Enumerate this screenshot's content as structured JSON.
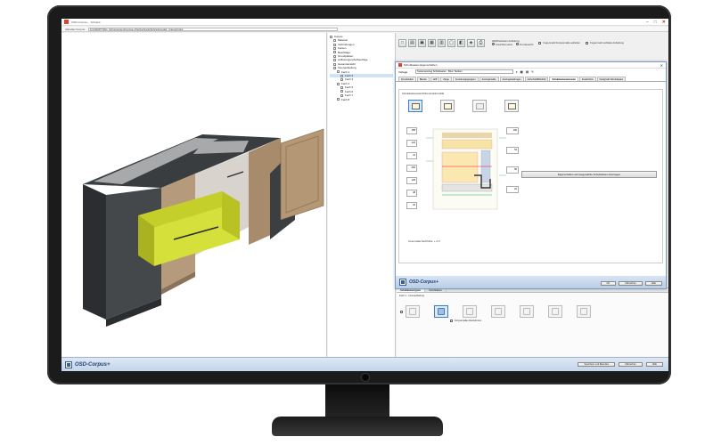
{
  "window": {
    "title": "OSD-Corpus+ · Schrank",
    "controls": {
      "minimize": "–",
      "maximize": "□",
      "close": "✕"
    }
  },
  "pathbar": {
    "label": "Aktueller Korpus:",
    "value": "S:\\OSD\\PTSSG_Schreinereien\\Corpus+\\Tischschrank\\Schrankmodell_Unterschrank"
  },
  "tree": {
    "items": [
      {
        "label": "Korpus",
        "level": 0
      },
      {
        "label": "Material",
        "level": 1
      },
      {
        "label": "Verbindungen",
        "level": 1
      },
      {
        "label": "Kanten",
        "level": 1
      },
      {
        "label": "Beschläge",
        "level": 1
      },
      {
        "label": "Grundplatten",
        "level": 1
      },
      {
        "label": "Auflösungen/Aufbaufolge",
        "level": 1
      },
      {
        "label": "Gesamtansicht",
        "level": 1
      },
      {
        "label": "Innenaufteilung",
        "level": 1
      },
      {
        "label": "Fach 1",
        "level": 2
      },
      {
        "label": "Fach 2",
        "level": 3
      },
      {
        "label": "Fach 3",
        "level": 3
      },
      {
        "label": "Fach 4",
        "level": 2
      },
      {
        "label": "Fach 5",
        "level": 3
      },
      {
        "label": "Fach 6",
        "level": 3
      },
      {
        "label": "Fach 7",
        "level": 3
      },
      {
        "label": "Fach 8",
        "level": 2
      }
    ],
    "selected_index": 10
  },
  "toolbar": {
    "buttons": [
      "new-icon",
      "open-icon",
      "save-icon",
      "grid-icon",
      "table-icon",
      "front-icon",
      "side-icon",
      "3d-icon",
      "print-icon"
    ],
    "group_label": "Wahlfreiheiten Aufteilung",
    "radio_a": "Ansichtsmodus",
    "radio_b": "Frontansicht",
    "pill_1": "Fugenmaß Korpusmaße aufteilen",
    "pill_2": "Fugenmaß vertikale Aufteilung"
  },
  "dialog": {
    "title": "Schubkasten-Eigenschaften",
    "close": "✕",
    "type_label": "Vorlage",
    "type_value": "Systemauszug Schubkasten · Blum Tandem",
    "tabs": [
      "Konstruktion",
      "Blende",
      "Griff",
      "Zarge",
      "Anordnungsgruppen",
      "Auszugsmaße",
      "Auszugsstellungen",
      "Aufschnitt/Bohrbild",
      "Schubkastenelemente",
      "Zusatzinfos",
      "Fertigmaß Schubkasten"
    ],
    "active_tab": 8,
    "group_caption": "Schubkastenansicht/Konstruktionsbild",
    "dim_labels_left": [
      "158",
      "124",
      "41",
      "256",
      "128",
      "48",
      "32"
    ],
    "dim_labels_right": [
      "100",
      "54",
      "56",
      "22"
    ],
    "apply_button": "Eigenschaften auf Ausgewählte Schubkästen übertragen",
    "stats": "Innenmaße Fachhöhe: + 2 N",
    "ok": "OK",
    "cancel": "Abbrechen",
    "help": "Hilfe"
  },
  "lower": {
    "tabs": [
      "Schubkastentypen",
      "Schubkästen"
    ],
    "caption": "Fach 1 - Innenaufteilung",
    "checkbox_label": "Korpusmaße übernehmen"
  },
  "statusbar": {
    "logo": "OSD-Corpus+",
    "btn_a": "Speichern und Beenden",
    "btn_b": "Abbrechen",
    "btn_c": "Hilfe"
  },
  "dialog_logo": "OSD-Corpus+"
}
